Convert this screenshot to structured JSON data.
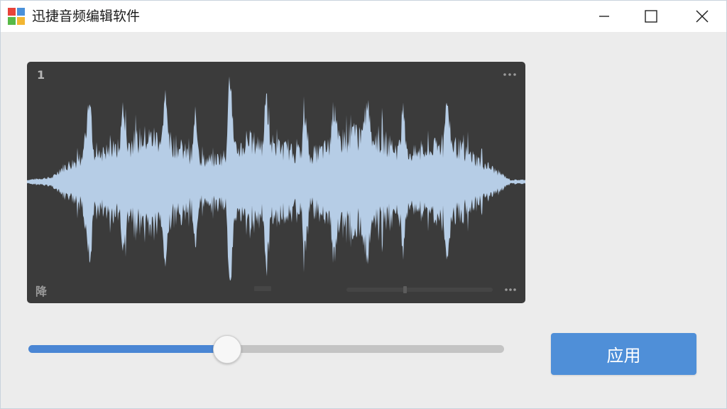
{
  "window": {
    "title": "迅捷音频编辑软件",
    "controls": [
      "minimize",
      "maximize",
      "close"
    ]
  },
  "colors": {
    "waveform": "#b6cde6",
    "panel_bg": "#3b3b3b",
    "accent": "#4a86d4",
    "apply_button": "#4f8fd8"
  },
  "waveform_panel": {
    "track_number": "1",
    "bottom_label": "降",
    "top_menu_icon": "more-dots-icon",
    "bottom_menu_icon": "more-dots-icon"
  },
  "slider": {
    "value_fraction": 0.416
  },
  "apply_button": {
    "label": "应用"
  }
}
